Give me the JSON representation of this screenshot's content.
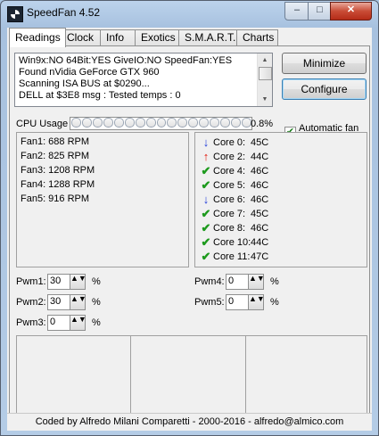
{
  "window": {
    "title": "SpeedFan 4.52",
    "minimize_glyph": "–",
    "maximize_glyph": "□",
    "close_glyph": "✕"
  },
  "tabs": [
    {
      "label": "Readings",
      "active": true
    },
    {
      "label": "Clock"
    },
    {
      "label": "Info"
    },
    {
      "label": "Exotics"
    },
    {
      "label": "S.M.A.R.T."
    },
    {
      "label": "Charts"
    }
  ],
  "log": {
    "lines": [
      "Win9x:NO  64Bit:YES  GiveIO:NO  SpeedFan:YES",
      "Found nVidia GeForce GTX 960",
      "Scanning ISA BUS at $0290...",
      "DELL at $3E8 msg : Tested temps : 0"
    ]
  },
  "buttons": {
    "minimize": "Minimize",
    "configure": "Configure"
  },
  "auto_fan": {
    "label": "Automatic fan speed",
    "checked": true,
    "check_glyph": "✔"
  },
  "cpu": {
    "label": "CPU Usage",
    "value": "0.8%",
    "segments": 17
  },
  "fans": [
    "Fan1: 688 RPM",
    "Fan2: 825 RPM",
    "Fan3: 1208 RPM",
    "Fan4: 1288 RPM",
    "Fan5: 916 RPM"
  ],
  "temps": [
    {
      "name": "Core 0:",
      "value": "45C",
      "icon": "arrow-down-icon",
      "glyph": "↓",
      "kind": "down"
    },
    {
      "name": "Core 2:",
      "value": "44C",
      "icon": "arrow-up-icon",
      "glyph": "↑",
      "kind": "up"
    },
    {
      "name": "Core 4:",
      "value": "46C",
      "icon": "check-icon",
      "glyph": "✔",
      "kind": "check-ico"
    },
    {
      "name": "Core 5:",
      "value": "46C",
      "icon": "check-icon",
      "glyph": "✔",
      "kind": "check-ico"
    },
    {
      "name": "Core 6:",
      "value": "46C",
      "icon": "arrow-down-icon",
      "glyph": "↓",
      "kind": "down"
    },
    {
      "name": "Core 7:",
      "value": "45C",
      "icon": "check-icon",
      "glyph": "✔",
      "kind": "check-ico"
    },
    {
      "name": "Core 8:",
      "value": "46C",
      "icon": "check-icon",
      "glyph": "✔",
      "kind": "check-ico"
    },
    {
      "name": "Core 10:",
      "value": "44C",
      "icon": "check-icon",
      "glyph": "✔",
      "kind": "check-ico"
    },
    {
      "name": "Core 11:",
      "value": "47C",
      "icon": "check-icon",
      "glyph": "✔",
      "kind": "check-ico"
    }
  ],
  "pwm": {
    "pwm1": {
      "label": "Pwm1:",
      "value": "30",
      "unit": "%"
    },
    "pwm2": {
      "label": "Pwm2:",
      "value": "30",
      "unit": "%"
    },
    "pwm3": {
      "label": "Pwm3:",
      "value": "0",
      "unit": "%"
    },
    "pwm4": {
      "label": "Pwm4:",
      "value": "0",
      "unit": "%"
    },
    "pwm5": {
      "label": "Pwm5:",
      "value": "0",
      "unit": "%"
    },
    "spin_glyph": "▲▼"
  },
  "status": {
    "text": "Coded by Alfredo Milani Comparetti - 2000-2016 - alfredo@almico.com"
  }
}
